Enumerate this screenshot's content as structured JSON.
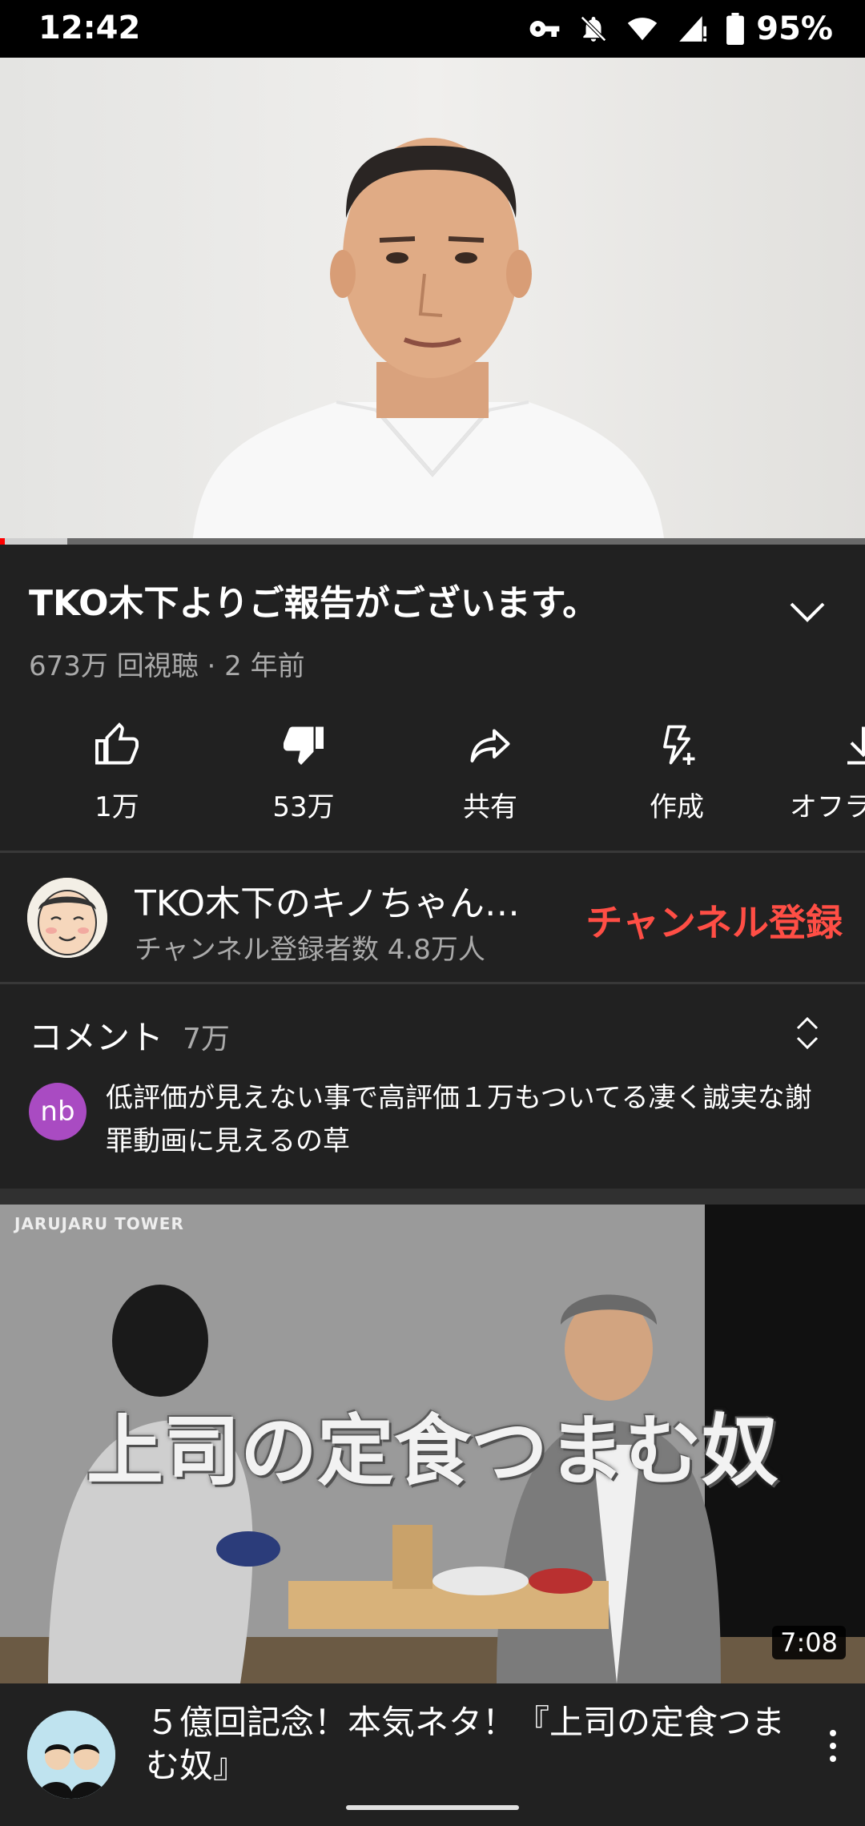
{
  "status_bar": {
    "time": "12:42",
    "battery": "95%"
  },
  "player": {
    "progress_played": 0.006,
    "progress_buffered": 0.078
  },
  "video": {
    "title": "TKO木下よりご報告がございます。",
    "meta": "673万 回視聴 · 2 年前"
  },
  "actions": [
    {
      "label": "1万",
      "icon": "thumbs-up-icon"
    },
    {
      "label": "53万",
      "icon": "thumbs-down-filled-icon"
    },
    {
      "label": "共有",
      "icon": "share-icon"
    },
    {
      "label": "作成",
      "icon": "create-icon"
    },
    {
      "label": "オフライン",
      "icon": "download-icon"
    }
  ],
  "channel": {
    "name": "TKO木下のキノちゃんねる",
    "subscribers": "チャンネル登録者数 4.8万人",
    "subscribe_label": "チャンネル登録"
  },
  "comments": {
    "header": "コメント",
    "count": "7万",
    "top_comment": {
      "avatar_initials": "nb",
      "avatar_color": "#a94bc2",
      "text": "低評価が見えない事で高評価１万もついてる凄く誠実な謝罪動画に見えるの草"
    }
  },
  "recommended": {
    "thumbnail_logo": "JARUJARU TOWER",
    "thumbnail_caption": "上司の定食つまむ奴",
    "duration": "7:08",
    "title": "５億回記念！本気ネタ！『上司の定食つまむ奴』"
  },
  "colors": {
    "background": "#212121",
    "subscribe": "#ff4e45",
    "progress": "#ff0000",
    "secondary_text": "#aaaaaa"
  }
}
